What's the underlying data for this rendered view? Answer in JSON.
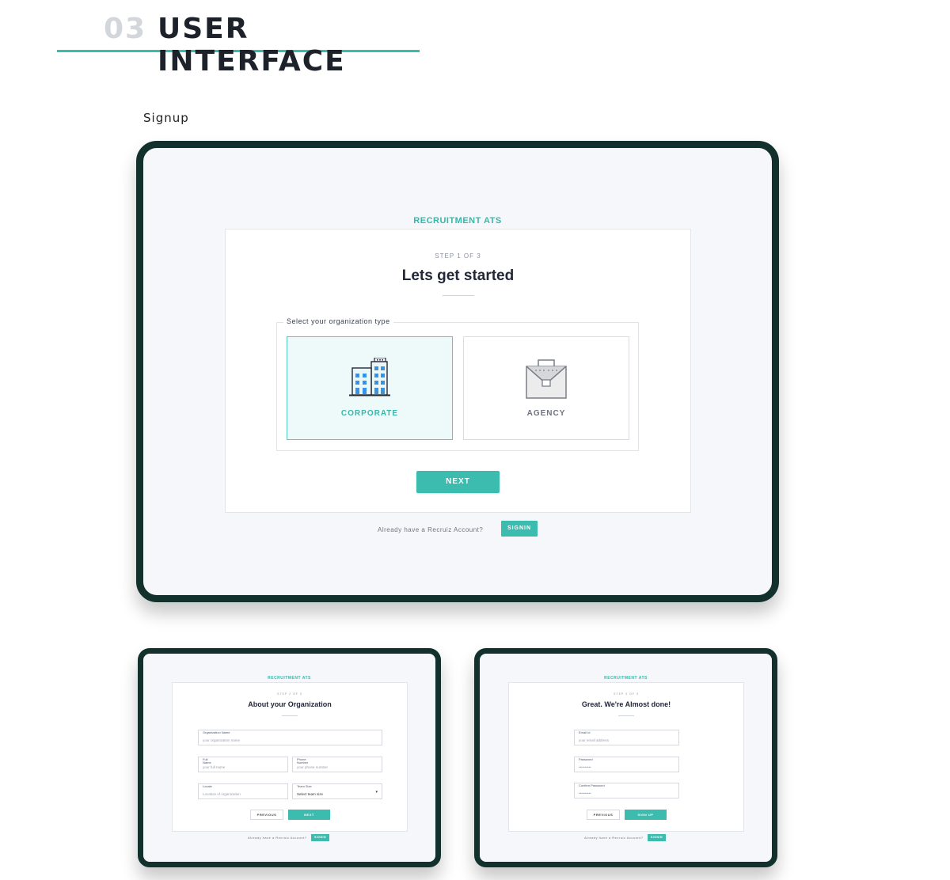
{
  "section": {
    "number": "03",
    "title": "USER INTERFACE"
  },
  "subtitle": "Signup",
  "step1": {
    "brand": "RECRUITMENT ATS",
    "step": "STEP 1 OF 3",
    "title": "Lets get started",
    "legend": "Select your organization type",
    "options": [
      {
        "label": "CORPORATE",
        "icon": "building-icon",
        "selected": true
      },
      {
        "label": "AGENCY",
        "icon": "briefcase-icon",
        "selected": false
      }
    ],
    "next_label": "NEXT",
    "already_text": "Already have a Recruiz Account?",
    "signin_label": "SIGNIN"
  },
  "step2": {
    "brand": "RECRUITMENT ATS",
    "step": "STEP 2 OF 3",
    "title": "About your Organization",
    "fields": {
      "org_name": {
        "label": "Organization Name",
        "placeholder": "your organization name"
      },
      "full_name": {
        "label": "Full Name",
        "placeholder": "your full name"
      },
      "phone": {
        "label": "Phone Number",
        "placeholder": "your phone number"
      },
      "locale": {
        "label": "Locale",
        "placeholder": "Location of organization"
      },
      "team_size": {
        "label": "Team Size",
        "value": "Select team size"
      }
    },
    "previous_label": "PREVIOUS",
    "next_label": "NEXT",
    "already_text": "Already have a Recruiz Account?",
    "signin_label": "SIGNIN"
  },
  "step3": {
    "brand": "RECRUITMENT ATS",
    "step": "STEP 3 OF 3",
    "title": "Great. We're Almost done!",
    "fields": {
      "email": {
        "label": "Email Id",
        "placeholder": "your email address"
      },
      "password": {
        "label": "Password",
        "placeholder": "••••••••••"
      },
      "confirm": {
        "label": "Confirm Password",
        "placeholder": "••••••••••"
      }
    },
    "previous_label": "PREVIOUS",
    "signup_label": "SIGN UP",
    "already_text": "Already have a Recruiz Account?",
    "signin_label": "SIGNIN"
  },
  "colors": {
    "accent": "#3bbcae",
    "frame": "#13312c",
    "screen_bg": "#f6f7fa",
    "heading_muted": "#d3d7dc"
  }
}
